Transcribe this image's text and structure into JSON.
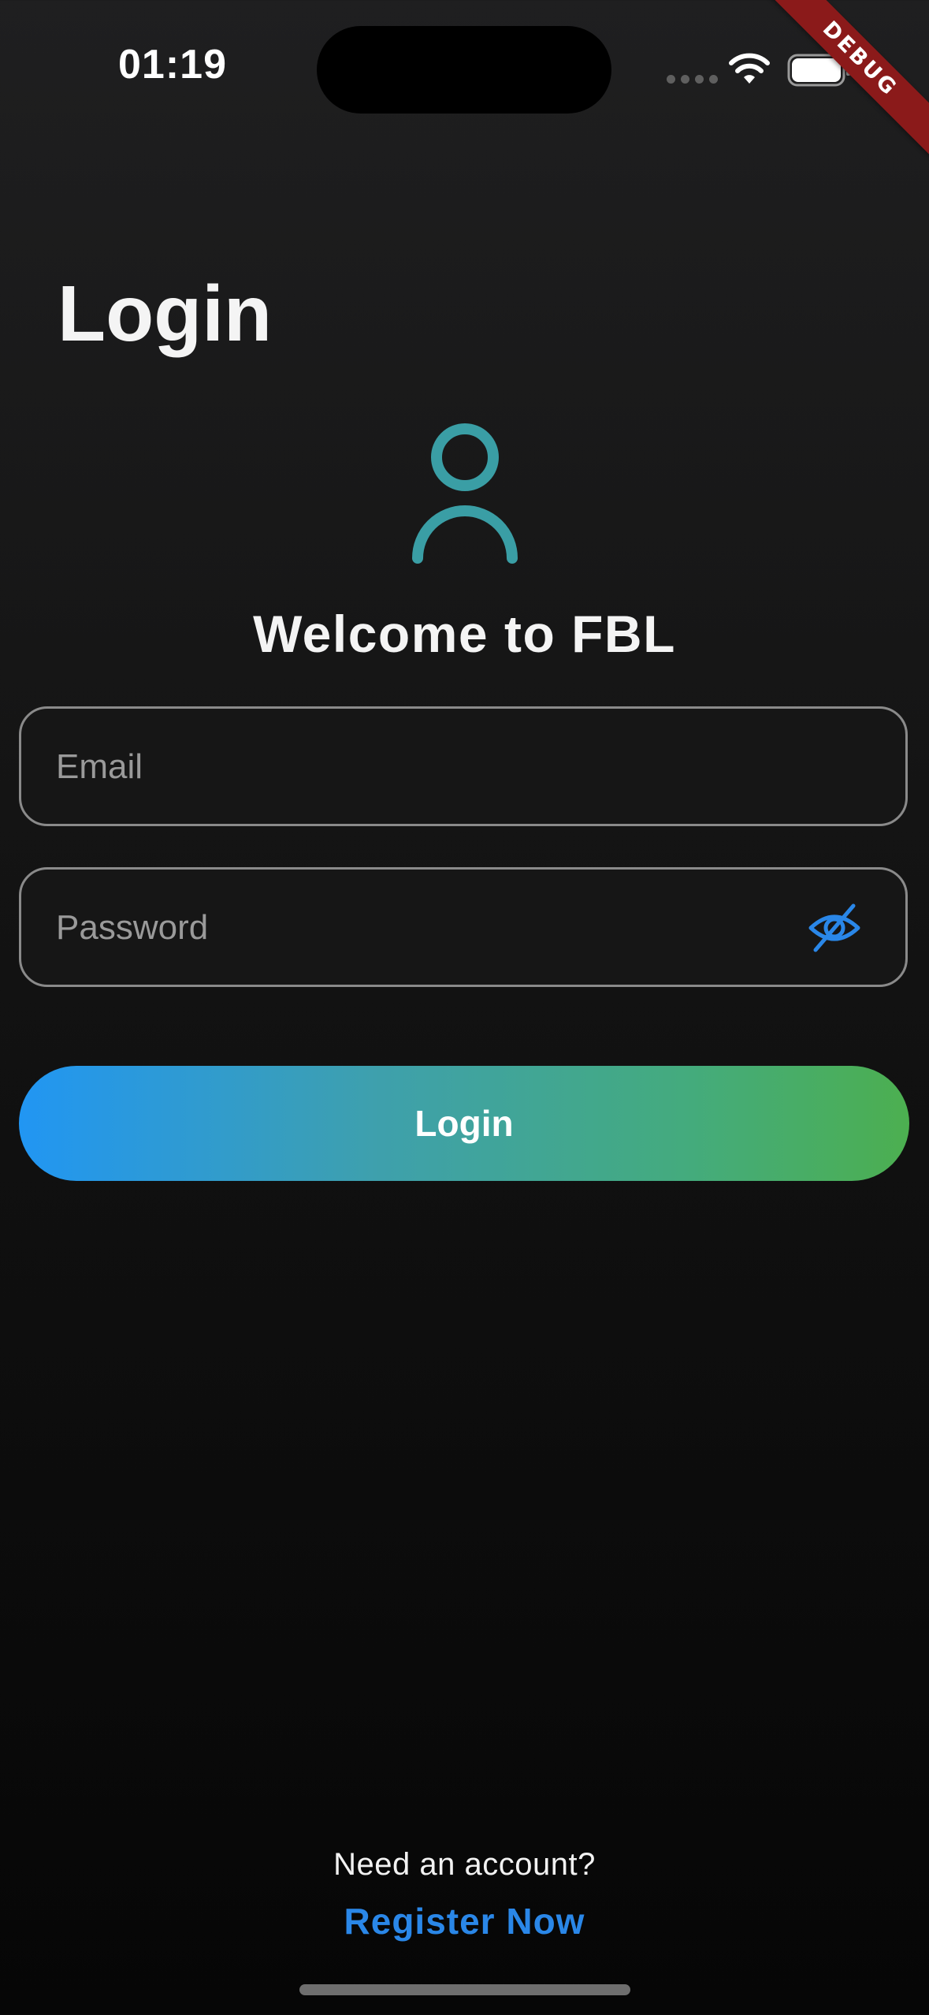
{
  "status_bar": {
    "time": "01:19"
  },
  "debug_banner": "DEBUG",
  "page": {
    "title": "Login",
    "welcome": "Welcome to FBL"
  },
  "form": {
    "email_placeholder": "Email",
    "email_value": "",
    "password_placeholder": "Password",
    "password_value": "",
    "login_label": "Login"
  },
  "footer": {
    "prompt": "Need an account?",
    "register_label": "Register Now"
  },
  "icons": {
    "person": "person-outline-icon",
    "visibility": "visibility-off-icon",
    "wifi": "wifi-icon",
    "battery": "battery-icon"
  },
  "colors": {
    "accent_teal": "#3a9ea5",
    "link_blue": "#2a87e8",
    "gradient_start": "#2196f3",
    "gradient_end": "#4caf50",
    "debug_red": "#8b1a1a"
  }
}
